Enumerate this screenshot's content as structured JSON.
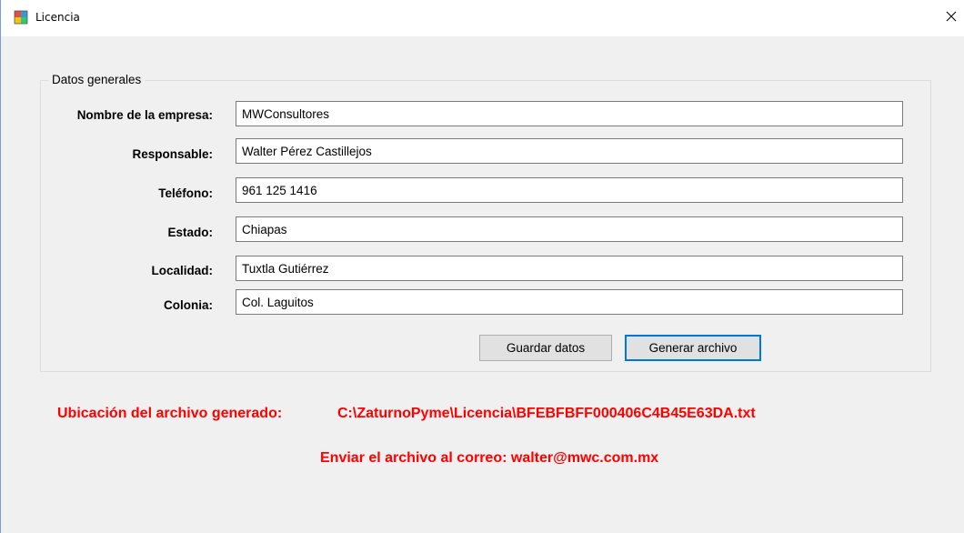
{
  "window": {
    "title": "Licencia"
  },
  "group": {
    "legend": "Datos generales"
  },
  "fields": [
    {
      "label": "Nombre de la empresa:",
      "value": "MWConsultores"
    },
    {
      "label": "Responsable:",
      "value": "Walter Pérez Castillejos"
    },
    {
      "label": "Teléfono:",
      "value": "961 125 1416"
    },
    {
      "label": "Estado:",
      "value": "Chiapas"
    },
    {
      "label": "Localidad:",
      "value": "Tuxtla Gutiérrez"
    },
    {
      "label": "Colonia:",
      "value": "Col. Laguitos"
    }
  ],
  "buttons": {
    "save": "Guardar datos",
    "generate": "Generar archivo"
  },
  "info": {
    "location_label": "Ubicación del archivo generado:",
    "location_path": "C:\\ZaturnoPyme\\Licencia\\BFEBFBFF000406C4B45E63DA.txt",
    "email_message": "Enviar el archivo al correo: walter@mwc.com.mx"
  },
  "colors": {
    "info_text": "#ff0000",
    "primary_button_border": "#0078d7"
  },
  "icons": {
    "app": "app-window-icon",
    "close": "close-icon"
  }
}
